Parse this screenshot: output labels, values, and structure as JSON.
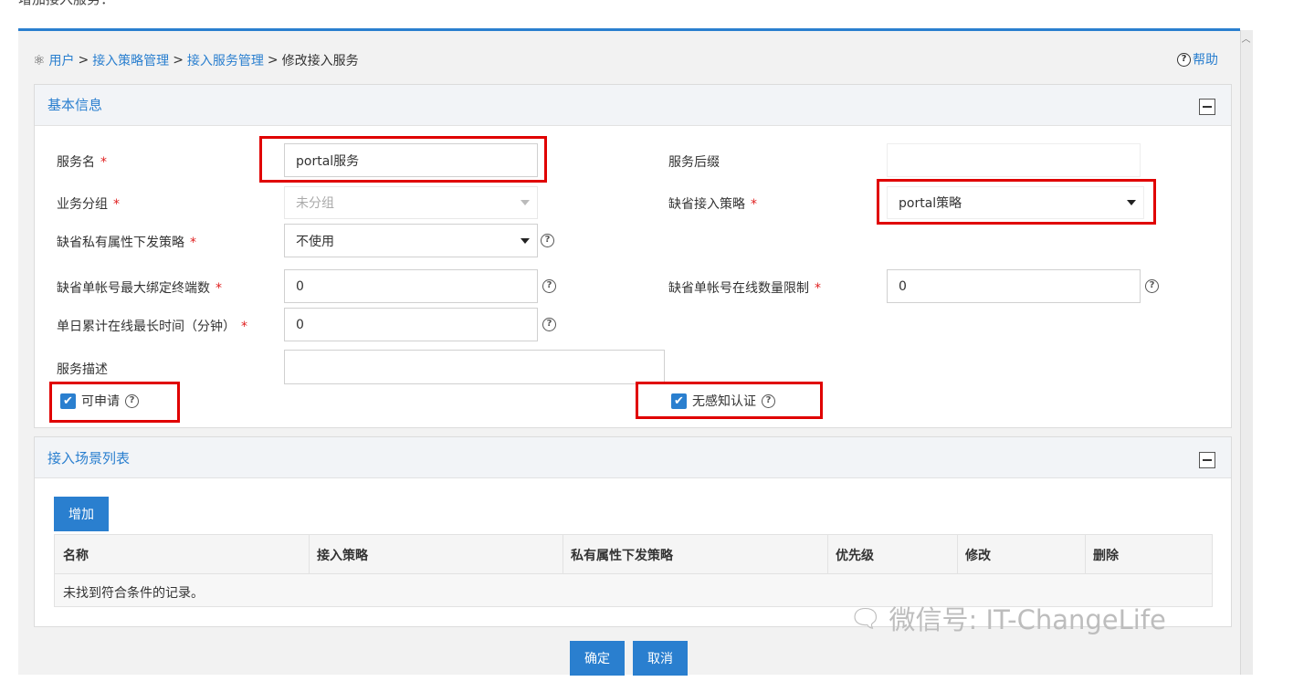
{
  "page_note": "增加接入服务：",
  "breadcrumb": {
    "items": [
      "用户",
      "接入策略管理",
      "接入服务管理"
    ],
    "separator": ">",
    "current": "修改接入服务"
  },
  "help_label": "帮助",
  "basic_info": {
    "title": "基本信息",
    "service_name_label": "服务名",
    "service_name_value": "portal服务",
    "service_suffix_label": "服务后缀",
    "service_suffix_value": "",
    "business_group_label": "业务分组",
    "business_group_value": "未分组",
    "default_access_policy_label": "缺省接入策略",
    "default_access_policy_value": "portal策略",
    "default_private_attr_label": "缺省私有属性下发策略",
    "default_private_attr_value": "不使用",
    "max_bound_terminals_label": "缺省单帐号最大绑定终端数",
    "max_bound_terminals_value": "0",
    "online_limit_label": "缺省单帐号在线数量限制",
    "online_limit_value": "0",
    "daily_online_label": "单日累计在线最长时间（分钟）",
    "daily_online_value": "0",
    "description_label": "服务描述",
    "description_value": "",
    "applicable_label": "可申请",
    "applicable_checked": true,
    "seamless_auth_label": "无感知认证",
    "seamless_auth_checked": true,
    "required_mark": "*"
  },
  "scenario_list": {
    "title": "接入场景列表",
    "add_button": "增加",
    "columns": [
      "名称",
      "接入策略",
      "私有属性下发策略",
      "优先级",
      "修改",
      "删除"
    ],
    "empty_message": "未找到符合条件的记录。"
  },
  "footer": {
    "confirm_button": "确定",
    "cancel_button": "取消"
  },
  "watermark": "微信号: IT-ChangeLife",
  "colors": {
    "accent": "#2a7fcf",
    "highlight_box": "#e00000",
    "required": "#e02020"
  }
}
